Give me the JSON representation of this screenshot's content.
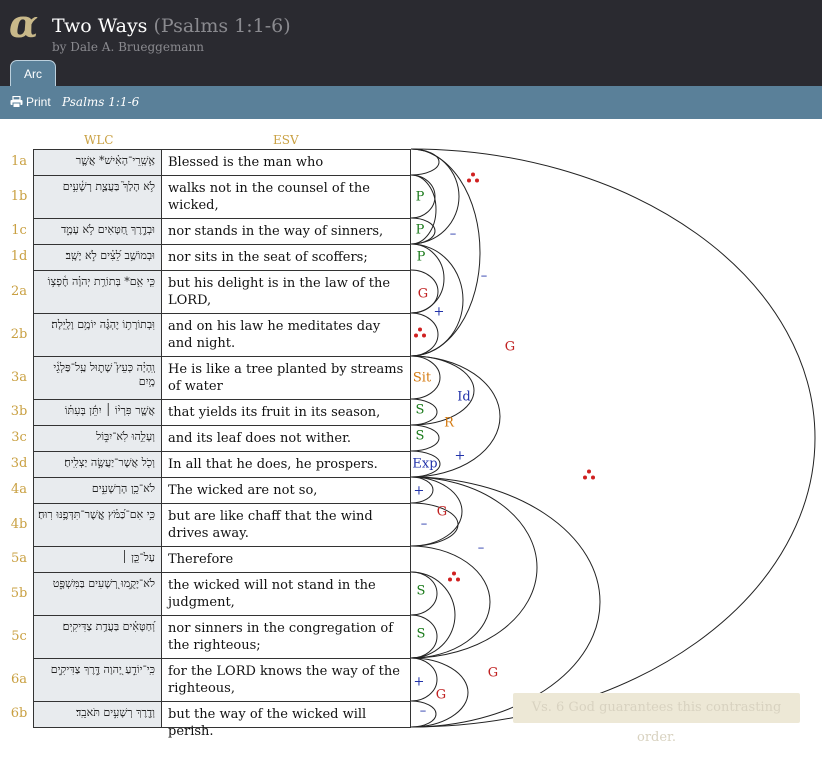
{
  "app": {
    "logo_icon": "alpha-logo-icon",
    "accent": "#5a8099",
    "header_bg": "#2a2a30"
  },
  "header": {
    "title": "Two Ways",
    "ref": "(Psalms 1:1-6)",
    "author": "by Dale A. Brueggemann"
  },
  "tabs": [
    {
      "label": "Arc",
      "active": true
    }
  ],
  "toolbar": {
    "print_label": "Print",
    "print_icon": "printer-icon",
    "passage": "Psalms 1:1-6"
  },
  "columns": {
    "wlc": "WLC",
    "esv": "ESV"
  },
  "rows": [
    {
      "v": "1a",
      "wlc": "אַ֥שְֽׁרֵי־הָאִ֗ישׁ* אֲשֶׁ֤ר",
      "esv": "Blessed is the man who"
    },
    {
      "v": "1b",
      "wlc": "לֹ֥א הָלַךְ֮ בַּעֲצַ֪ת רְשָׁ֫עִ֥ים",
      "esv": "walks not in the counsel of the wicked,"
    },
    {
      "v": "1c",
      "wlc": "וּבְדֶ֣רֶךְ חַ֭טָּאִים לֹ֥א עָמָ֑ד",
      "esv": "nor stands in the way of sinners,"
    },
    {
      "v": "1d",
      "wlc": "וּבְמוֹשַׁ֥ב לֵ֝צִ֗ים לֹ֣א יָשָֽׁב׃",
      "esv": "nor sits in the seat of scoffers;"
    },
    {
      "v": "2a",
      "wlc": "כִּ֤י אִ֥ם* בְּתוֹרַ֥ת יְהוָ֗ה חֶ֫פְצ֥וֹ",
      "esv": "but his delight is in the law of the LORD,"
    },
    {
      "v": "2b",
      "wlc": "וּֽבְתוֹרָת֥וֹ יֶהְגֶּ֗ה יוֹמָ֥ם וָלָֽיְלָה׃",
      "esv": "and on his law he meditates day and night."
    },
    {
      "v": "3a",
      "wlc": "וְֽהָיָ֗ה כְּעֵץ֮ שָׁת֪וּל עַֽל־פַּלְגֵ֫י מָ֥יִם",
      "esv": "He is like a tree planted by streams of water"
    },
    {
      "v": "3b",
      "wlc": "אֲשֶׁ֤ר פִּרְי֨וֹ ׀ יִתֵּ֬ן בְּעִתּ֗וֹ",
      "esv": "that yields its fruit in its season,"
    },
    {
      "v": "3c",
      "wlc": "וְעָלֵ֥הוּ לֹֽא־יִבּ֑וֹל",
      "esv": "and its leaf does not wither."
    },
    {
      "v": "3d",
      "wlc": "וְכֹ֖ל אֲשֶׁר־יַעֲשֶׂ֣ה יַצְלִֽיחַ׃",
      "esv": "In all that he does, he prospers."
    },
    {
      "v": "4a",
      "wlc": "לֹא־כֵ֥ן הָרְשָׁעִ֑ים",
      "esv": "The wicked are not so,"
    },
    {
      "v": "4b",
      "wlc": "כִּ֥י אִם־כַּ֝מֹּ֗ץ אֲֽשֶׁר־תִּדְּפֶ֥נּוּ רֽוּחַ׃",
      "esv": "but are like chaff that the wind drives away."
    },
    {
      "v": "5a",
      "wlc": "עַל־כֵּ֤ן ׀",
      "esv": "Therefore"
    },
    {
      "v": "5b",
      "wlc": "לֹא־יָקֻ֣מוּ רְ֭שָׁעִים בַּמִּשְׁפָּ֑ט",
      "esv": "the wicked will not stand in the judgment,"
    },
    {
      "v": "5c",
      "wlc": "וְ֝חַטָּאִ֗ים בַּעֲדַ֥ת צַדִּיקִֽים׃",
      "esv": "nor sinners in the congregation of the righteous;"
    },
    {
      "v": "6a",
      "wlc": "כִּֽי־יוֹדֵ֣עַ יְ֭הוָה דֶּ֣רֶךְ צַדִּיקִ֑ים",
      "esv": "for the LORD knows the way of the righteous,"
    },
    {
      "v": "6b",
      "wlc": "וְדֶ֖רֶךְ רְשָׁעִ֣ים תֹּאבֵֽד׃",
      "esv": "but the way of the wicked will perish."
    }
  ],
  "arc_labels": [
    {
      "text": "P",
      "kind": "P"
    },
    {
      "text": "P",
      "kind": "P"
    },
    {
      "text": "P",
      "kind": "P"
    },
    {
      "text": "–",
      "kind": "minus"
    },
    {
      "text": "–",
      "kind": "minus"
    },
    {
      "text": "G",
      "kind": "G"
    },
    {
      "text": "+",
      "kind": "plus"
    },
    {
      "text": "G",
      "kind": "G"
    },
    {
      "text": "Sit",
      "kind": "Sit"
    },
    {
      "text": "Id",
      "kind": "Id"
    },
    {
      "text": "S",
      "kind": "S"
    },
    {
      "text": "R",
      "kind": "R"
    },
    {
      "text": "S",
      "kind": "S"
    },
    {
      "text": "Exp",
      "kind": "Exp"
    },
    {
      "text": "+",
      "kind": "plus"
    },
    {
      "text": "+",
      "kind": "plus"
    },
    {
      "text": "–",
      "kind": "minus"
    },
    {
      "text": "G",
      "kind": "G"
    },
    {
      "text": "–",
      "kind": "minus"
    },
    {
      "text": "S",
      "kind": "S"
    },
    {
      "text": "S",
      "kind": "S"
    },
    {
      "text": "+",
      "kind": "plus"
    },
    {
      "text": "G",
      "kind": "G"
    },
    {
      "text": "G",
      "kind": "G"
    },
    {
      "text": "–",
      "kind": "minus"
    }
  ],
  "summary": "Vs. 6 God guarantees this contrasting order."
}
